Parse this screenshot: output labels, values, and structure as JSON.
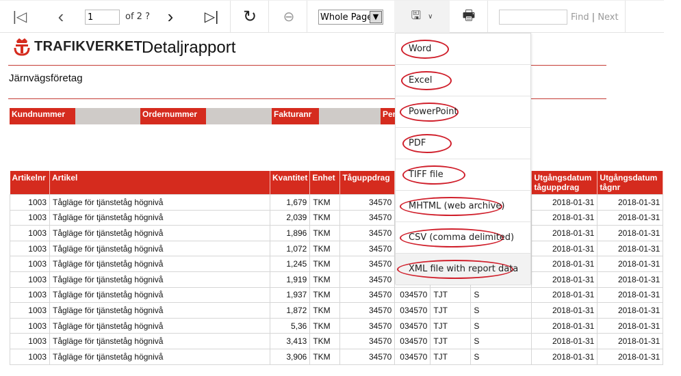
{
  "toolbar": {
    "page": "1",
    "of_label": "of 2 ?",
    "zoom": "Whole Page",
    "find_label": "Find",
    "next_label": "Next",
    "find_value": ""
  },
  "logo": {
    "text": "TRAFIKVERKET"
  },
  "report": {
    "title": "Detaljrapport",
    "subtitle": "Järnvägsföretag"
  },
  "params": [
    "Kundnummer",
    "Ordernummer",
    "Fakturanr",
    "Per"
  ],
  "table": {
    "headers": [
      "Artikelnr",
      "Artikel",
      "Kvantitet",
      "Enhet",
      "Tåguppdrag",
      "",
      "",
      "",
      "Utgångsdatum tåguppdrag",
      "Utgångsdatum tågnr"
    ],
    "rows": [
      [
        "1003",
        "Tågläge för tjänstetåg högnivå",
        "1,679",
        "TKM",
        "34570",
        "",
        "",
        "",
        "2018-01-31",
        "2018-01-31"
      ],
      [
        "1003",
        "Tågläge för tjänstetåg högnivå",
        "2,039",
        "TKM",
        "34570",
        "",
        "",
        "",
        "2018-01-31",
        "2018-01-31"
      ],
      [
        "1003",
        "Tågläge för tjänstetåg högnivå",
        "1,896",
        "TKM",
        "34570",
        "",
        "",
        "",
        "2018-01-31",
        "2018-01-31"
      ],
      [
        "1003",
        "Tågläge för tjänstetåg högnivå",
        "1,072",
        "TKM",
        "34570",
        "",
        "",
        "",
        "2018-01-31",
        "2018-01-31"
      ],
      [
        "1003",
        "Tågläge för tjänstetåg högnivå",
        "1,245",
        "TKM",
        "34570",
        "",
        "",
        "",
        "2018-01-31",
        "2018-01-31"
      ],
      [
        "1003",
        "Tågläge för tjänstetåg högnivå",
        "1,919",
        "TKM",
        "34570",
        "",
        "",
        "",
        "2018-01-31",
        "2018-01-31"
      ],
      [
        "1003",
        "Tågläge för tjänstetåg högnivå",
        "1,937",
        "TKM",
        "34570",
        "034570",
        "TJT",
        "S",
        "2018-01-31",
        "2018-01-31"
      ],
      [
        "1003",
        "Tågläge för tjänstetåg högnivå",
        "1,872",
        "TKM",
        "34570",
        "034570",
        "TJT",
        "S",
        "2018-01-31",
        "2018-01-31"
      ],
      [
        "1003",
        "Tågläge för tjänstetåg högnivå",
        "5,36",
        "TKM",
        "34570",
        "034570",
        "TJT",
        "S",
        "2018-01-31",
        "2018-01-31"
      ],
      [
        "1003",
        "Tågläge för tjänstetåg högnivå",
        "3,413",
        "TKM",
        "34570",
        "034570",
        "TJT",
        "S",
        "2018-01-31",
        "2018-01-31"
      ],
      [
        "1003",
        "Tågläge för tjänstetåg högnivå",
        "3,906",
        "TKM",
        "34570",
        "034570",
        "TJT",
        "S",
        "2018-01-31",
        "2018-01-31"
      ]
    ]
  },
  "export_menu": {
    "items": [
      "Word",
      "Excel",
      "PowerPoint",
      "PDF",
      "TIFF file",
      "MHTML (web archive)",
      "CSV (comma delimited)",
      "XML file with report data"
    ],
    "hovered": "XML file with report data"
  },
  "colors": {
    "brand_red": "#d52b1e",
    "annotation_red": "#d01f2b"
  }
}
